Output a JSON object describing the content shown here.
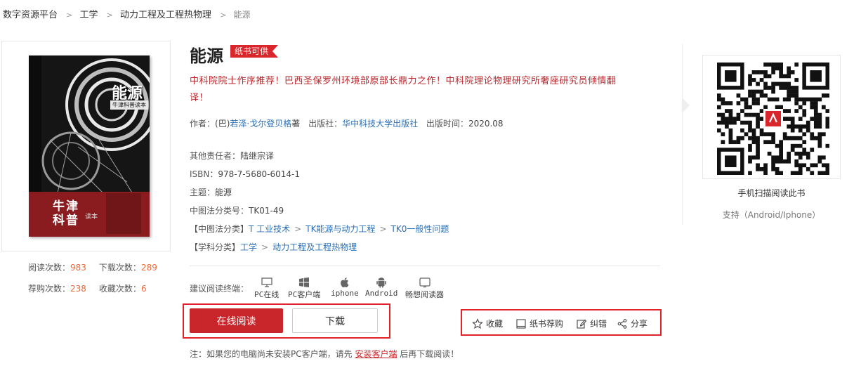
{
  "breadcrumb": {
    "root": "数字资源平台",
    "level1": "工学",
    "level2": "动力工程及工程热物理",
    "current": "能源",
    "separator": ">"
  },
  "book": {
    "title": "能源",
    "badge": "纸书可供",
    "description": "中科院院士作序推荐！巴西圣保罗州环境部原部长鼎力之作！中科院理论物理研究所奢座研究员倾情翻译！",
    "cover": {
      "title": "能源",
      "series": "牛津科普读本",
      "brand_line1": "牛津",
      "brand_line2": "科普",
      "brand_small": "读本"
    }
  },
  "stats": {
    "read_label": "阅读次数：",
    "read_count": "983",
    "download_label": "下载次数：",
    "download_count": "289",
    "recommend_label": "荐购次数：",
    "recommend_count": "238",
    "favorite_label": "收藏次数：",
    "favorite_count": "6"
  },
  "meta": {
    "author_label": "作者：",
    "author_prefix": "(巴)",
    "author_name": "若泽·戈尔登贝格",
    "author_suffix": "著",
    "publisher_label": "出版社：",
    "publisher": "华中科技大学出版社",
    "pubdate_label": "出版时间：",
    "pubdate": "2020.08",
    "other_label": "其他责任者：",
    "other": "陆继宗译",
    "isbn_label": "ISBN：",
    "isbn": "978-7-5680-6014-1",
    "subject_label": "主题：",
    "subject": "能源",
    "clc_label": "中图法分类号：",
    "clc": "TK01-49",
    "clc_cat_label": "【中图法分类】",
    "clc_cat_1": "T 工业技术",
    "clc_cat_2": "TK能源与动力工程",
    "clc_cat_3": "TK0一般性问题",
    "discipline_label": "【学科分类】",
    "discipline_1": "工学",
    "discipline_2": "动力工程及工程热物理",
    "arrow": ">"
  },
  "terminals": {
    "label": "建议阅读终端：",
    "items": [
      {
        "label": "PC在线",
        "icon": "monitor-icon"
      },
      {
        "label": "PC客户端",
        "icon": "windows-icon"
      },
      {
        "label": "iphone",
        "icon": "apple-icon"
      },
      {
        "label": "Android",
        "icon": "android-icon"
      },
      {
        "label": "畅想阅读器",
        "icon": "tablet-icon"
      }
    ]
  },
  "buttons": {
    "read_online": "在线阅读",
    "download": "下载"
  },
  "actions": {
    "favorite": "收藏",
    "recommend": "纸书荐购",
    "correct": "纠错",
    "share": "分享"
  },
  "note": {
    "prefix": "注：如果您的电脑尚未安装PC客户端，请先",
    "link": "安装客户端",
    "suffix": "后再下载阅读！"
  },
  "qr": {
    "caption": "手机扫描阅读此书",
    "support": "支持（Android/Iphone）"
  },
  "colors": {
    "accent": "#c9262b",
    "link": "#2a6fb7",
    "count": "#e96a3b",
    "highlight_box": "#e0232a"
  }
}
